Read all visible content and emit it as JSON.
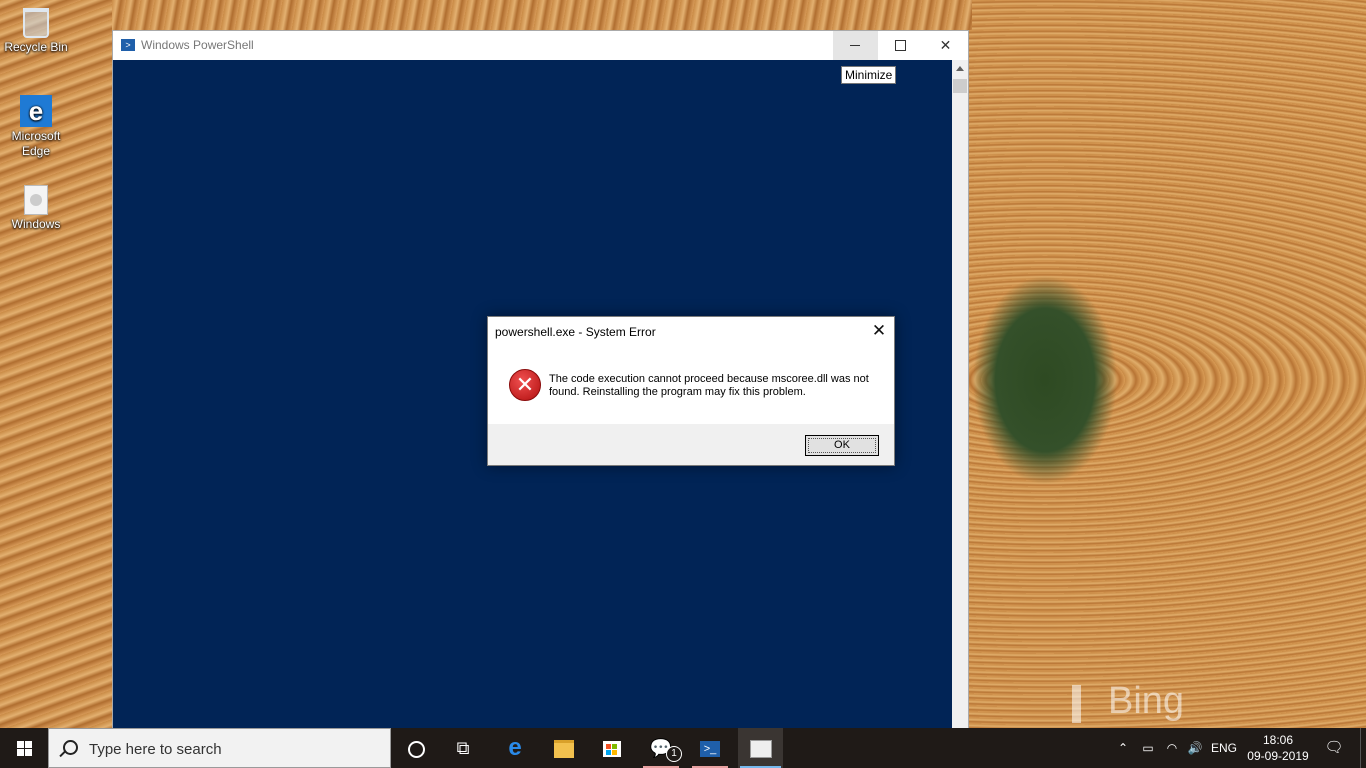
{
  "desktop": {
    "icons": [
      {
        "label": "Recycle Bin",
        "icon": "recycle-bin-icon"
      },
      {
        "label": "Microsoft\nEdge",
        "icon": "edge-icon"
      },
      {
        "label": "Windows",
        "icon": "document-icon"
      }
    ],
    "wallpaper_watermark": "Bing"
  },
  "powershell_window": {
    "title": "Windows PowerShell",
    "console_bg": "#012456",
    "tooltip": "Minimize"
  },
  "error_dialog": {
    "title": "powershell.exe - System Error",
    "close_glyph": "✕",
    "icon": "error-icon",
    "message": "The code execution cannot proceed because mscoree.dll was not found. Reinstalling the program may fix this problem.",
    "ok_label": "OK"
  },
  "taskbar": {
    "search_placeholder": "Type here to search",
    "feedback_badge": "1",
    "language": "ENG",
    "time": "18:06",
    "date": "09-09-2019"
  }
}
